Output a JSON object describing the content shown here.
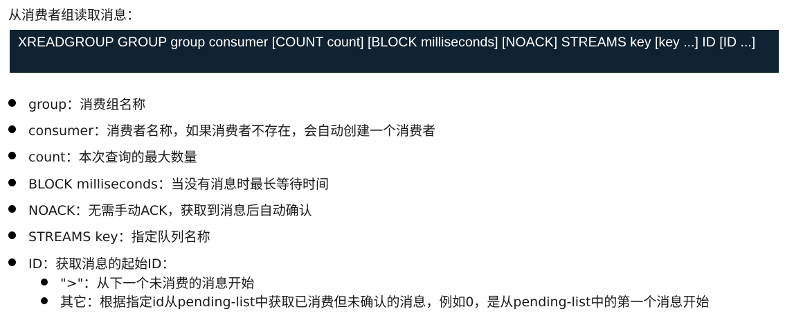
{
  "intro": "从消费者组读取消息：",
  "code": "XREADGROUP GROUP group consumer [COUNT count] [BLOCK milliseconds] [NOACK] STREAMS key [key ...] ID [ID ...]",
  "items": [
    "group：消费组名称",
    "consumer：消费者名称，如果消费者不存在，会自动创建一个消费者",
    "count：本次查询的最大数量",
    "BLOCK milliseconds：当没有消息时最长等待时间",
    "NOACK：无需手动ACK，获取到消息后自动确认",
    "STREAMS key：指定队列名称",
    "ID：获取消息的起始ID："
  ],
  "subitems": [
    "\">\"：从下一个未消费的消息开始",
    "其它：根据指定id从pending-list中获取已消费但未确认的消息，例如0，是从pending-list中的第一个消息开始"
  ]
}
